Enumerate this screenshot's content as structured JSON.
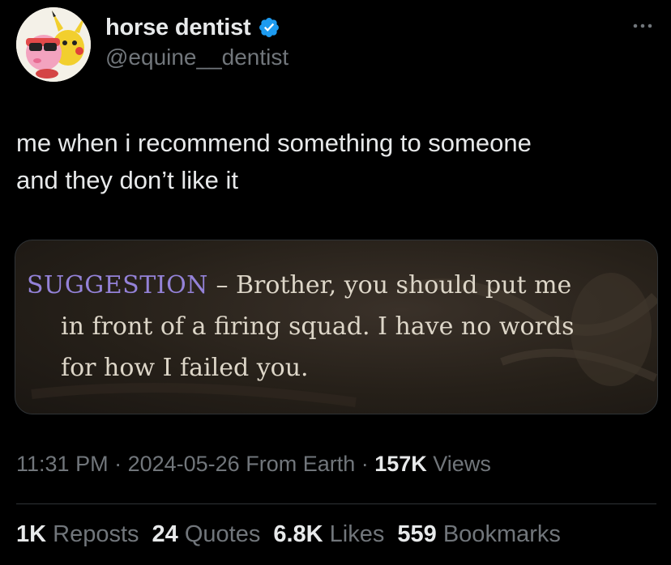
{
  "author": {
    "display_name": "horse dentist",
    "handle": "@equine__dentist",
    "verified": true,
    "verified_color": "#1d9bf0",
    "avatar_icon": "kirby-pikachu-avatar-icon"
  },
  "more_icon": "more-options-icon",
  "tweet": {
    "text": "me when i recommend something to someone\nand they don’t like it"
  },
  "media": {
    "lead": "SUGGESTION",
    "line1_rest": " – Brother, you should put me",
    "line2": "in front of a firing squad. I have no words",
    "line3": "for how I failed you.",
    "lead_color": "#9482d8"
  },
  "meta": {
    "time": "11:31 PM",
    "separator1": " · ",
    "date": "2024-05-26",
    "source": " From Earth",
    "separator2": " · ",
    "views_count": "157K",
    "views_label": " Views"
  },
  "stats": {
    "reposts_count": "1K",
    "reposts_label": " Reposts",
    "quotes_count": "24",
    "quotes_label": " Quotes",
    "likes_count": "6.8K",
    "likes_label": " Likes",
    "bookmarks_count": "559",
    "bookmarks_label": " Bookmarks"
  }
}
